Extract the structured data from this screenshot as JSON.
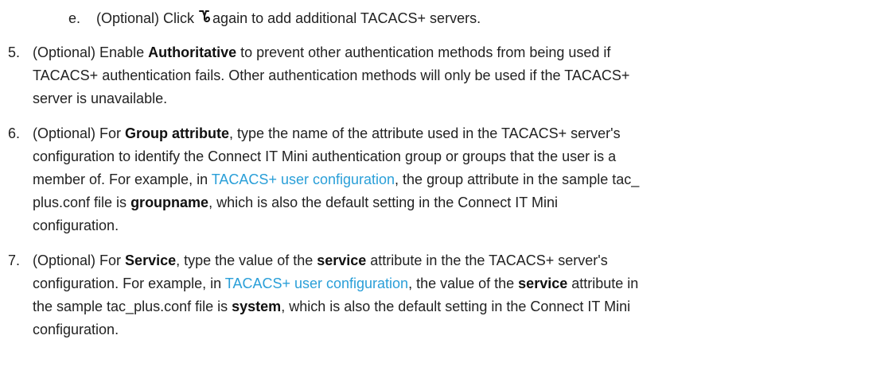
{
  "step_e": {
    "marker": "e.",
    "pre": "(Optional) Click",
    "icon": "add-icon",
    "post": "again to add additional TACACS+ servers."
  },
  "step5": {
    "number": "5.",
    "line1_pre": "(Optional) Enable ",
    "line1_bold": "Authoritative",
    "line1_post": " to prevent other authentication methods from being used if",
    "line2": "TACACS+ authentication fails. Other authentication methods will only be used if the TACACS+",
    "line3": "server is unavailable."
  },
  "step6": {
    "number": "6.",
    "line1_pre": "(Optional) For ",
    "line1_bold": "Group attribute",
    "line1_post": ", type the name of the attribute used in the TACACS+ server's",
    "line2": "configuration to identify the Connect IT Mini authentication group or groups that the user is a",
    "line3_pre": "member of. For example, in ",
    "line3_link": "TACACS+ user configuration",
    "line3_post": ", the group attribute in the sample tac_",
    "line4_pre": "plus.conf file is ",
    "line4_bold": "groupname",
    "line4_post": ", which is also the default setting in the Connect IT Mini",
    "line5": "configuration."
  },
  "step7": {
    "number": "7.",
    "line1_pre": "(Optional) For ",
    "line1_bold1": "Service",
    "line1_mid": ", type the value of the ",
    "line1_bold2": "service",
    "line1_post": " attribute in the the TACACS+ server's",
    "line2_pre": "configuration. For example, in ",
    "line2_link": "TACACS+ user configuration",
    "line2_mid": ", the value of the ",
    "line2_bold": "service",
    "line2_post": " attribute in",
    "line3_pre": "the sample tac_plus.conf file is ",
    "line3_bold": "system",
    "line3_post": ", which is also the default setting in the Connect IT Mini",
    "line4": "configuration."
  }
}
